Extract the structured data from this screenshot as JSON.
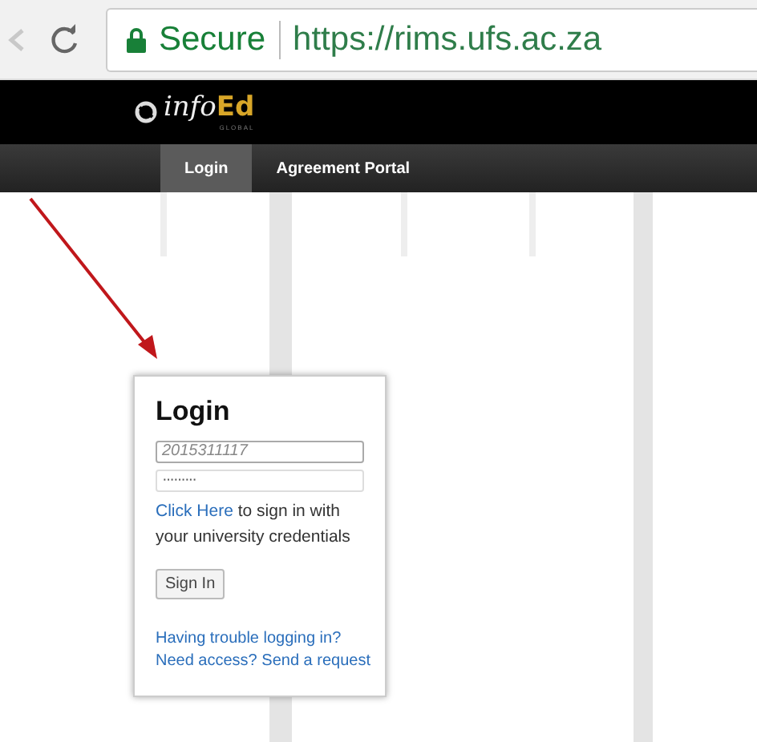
{
  "browser": {
    "security_label": "Secure",
    "url": "https://rims.ufs.ac.za"
  },
  "header": {
    "logo": "info",
    "logo_accent": "Ed",
    "logo_tagline": "GLOBAL"
  },
  "nav_tabs": [
    {
      "label": "Login",
      "selected": true
    },
    {
      "label": "Agreement Portal",
      "selected": false
    }
  ],
  "login": {
    "title": "Login",
    "username": "2015311117",
    "password": "·········",
    "sso_link": "Click Here",
    "sso_text": "to sign in with your university credentials",
    "sign_in": "Sign In",
    "help_links": [
      "Having trouble logging in?",
      "Need access? Send a request"
    ]
  }
}
